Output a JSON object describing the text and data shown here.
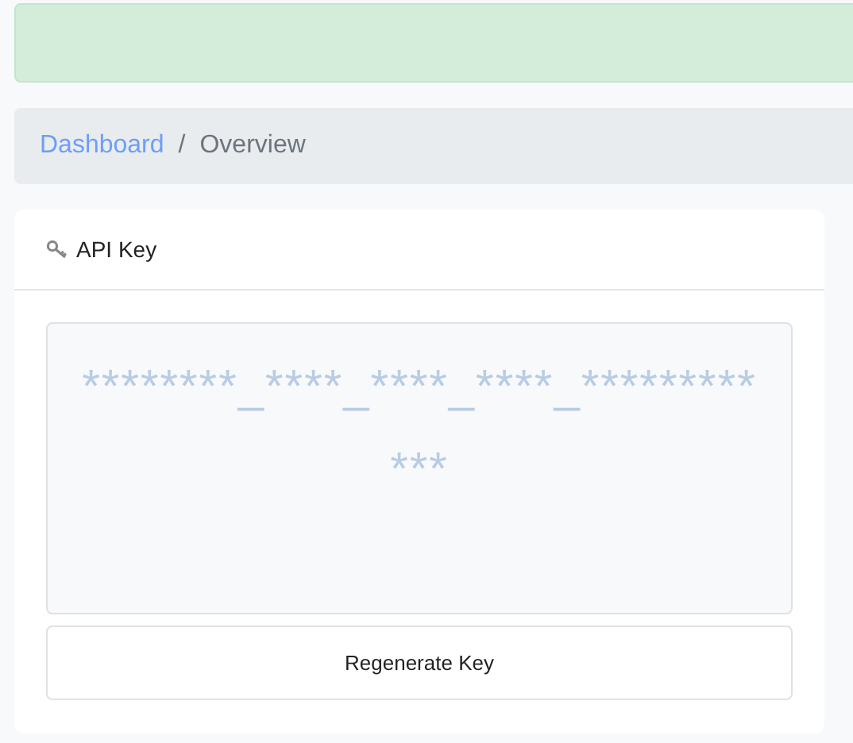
{
  "alert": {
    "kind": "success"
  },
  "breadcrumb": [
    {
      "label": "Dashboard",
      "kind": "link"
    },
    {
      "label": "/",
      "kind": "separator"
    },
    {
      "label": "Overview",
      "kind": "current"
    }
  ],
  "card": {
    "title": "API Key",
    "key": "********_****_****_****_************",
    "button": "Regenerate Key"
  }
}
